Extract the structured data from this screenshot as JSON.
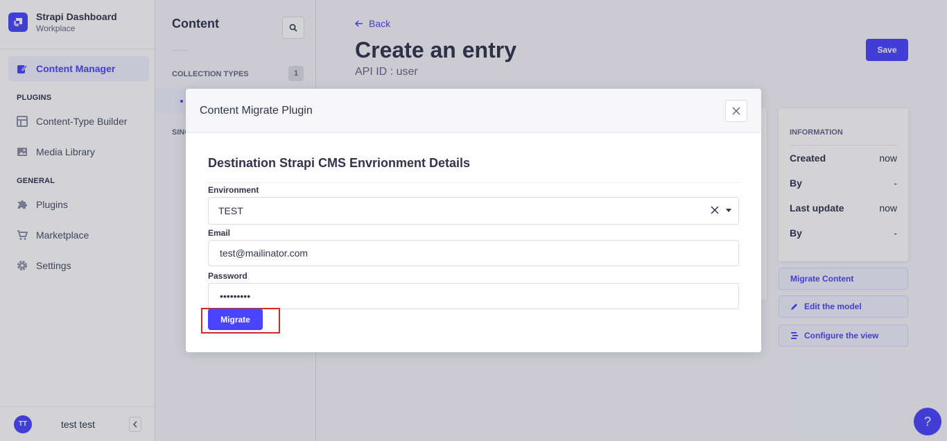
{
  "brand": {
    "title": "Strapi Dashboard",
    "subtitle": "Workplace"
  },
  "sidebar": {
    "main_item": "Content Manager",
    "plugins_label": "PLUGINS",
    "plugins": [
      "Content-Type Builder",
      "Media Library"
    ],
    "general_label": "GENERAL",
    "general": [
      "Plugins",
      "Marketplace",
      "Settings"
    ],
    "user": {
      "initials": "TT",
      "name": "test test"
    }
  },
  "subnav": {
    "title": "Content",
    "collection_types_label": "COLLECTION TYPES",
    "collection_count": "1",
    "single_types_label": "SING"
  },
  "page": {
    "back_label": "Back",
    "title": "Create an entry",
    "api_id": "API ID : user",
    "save_label": "Save"
  },
  "info": {
    "title": "INFORMATION",
    "rows": [
      {
        "label": "Created",
        "value": "now"
      },
      {
        "label": "By",
        "value": "-"
      },
      {
        "label": "Last update",
        "value": "now"
      },
      {
        "label": "By",
        "value": "-"
      }
    ]
  },
  "actions": {
    "migrate_content": "Migrate Content",
    "edit_model": "Edit the model",
    "configure_view": "Configure the view"
  },
  "help_label": "?",
  "modal": {
    "title": "Content Migrate Plugin",
    "heading": "Destination Strapi CMS Envrionment Details",
    "environment_label": "Environment",
    "environment_value": "TEST",
    "email_label": "Email",
    "email_value": "test@mailinator.com",
    "password_label": "Password",
    "password_value": "•••••••••",
    "migrate_label": "Migrate"
  },
  "colors": {
    "primary": "#4945ff",
    "highlight": "#d02b20"
  }
}
